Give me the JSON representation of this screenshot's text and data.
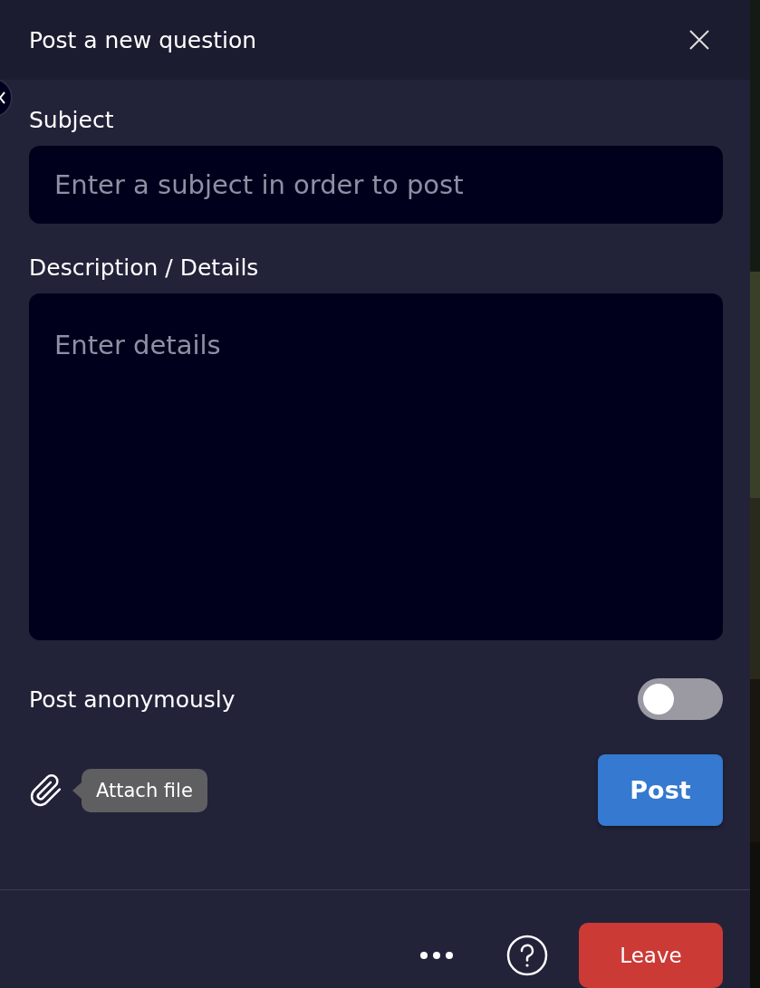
{
  "dialog": {
    "title": "Post a new question"
  },
  "subject": {
    "label": "Subject",
    "placeholder": "Enter a subject in order to post"
  },
  "description": {
    "label": "Description / Details",
    "placeholder": "Enter details"
  },
  "anonymous": {
    "label": "Post anonymously",
    "on": false
  },
  "attach": {
    "tooltip": "Attach file"
  },
  "post_button": "Post",
  "footer": {
    "leave_button": "Leave"
  }
}
